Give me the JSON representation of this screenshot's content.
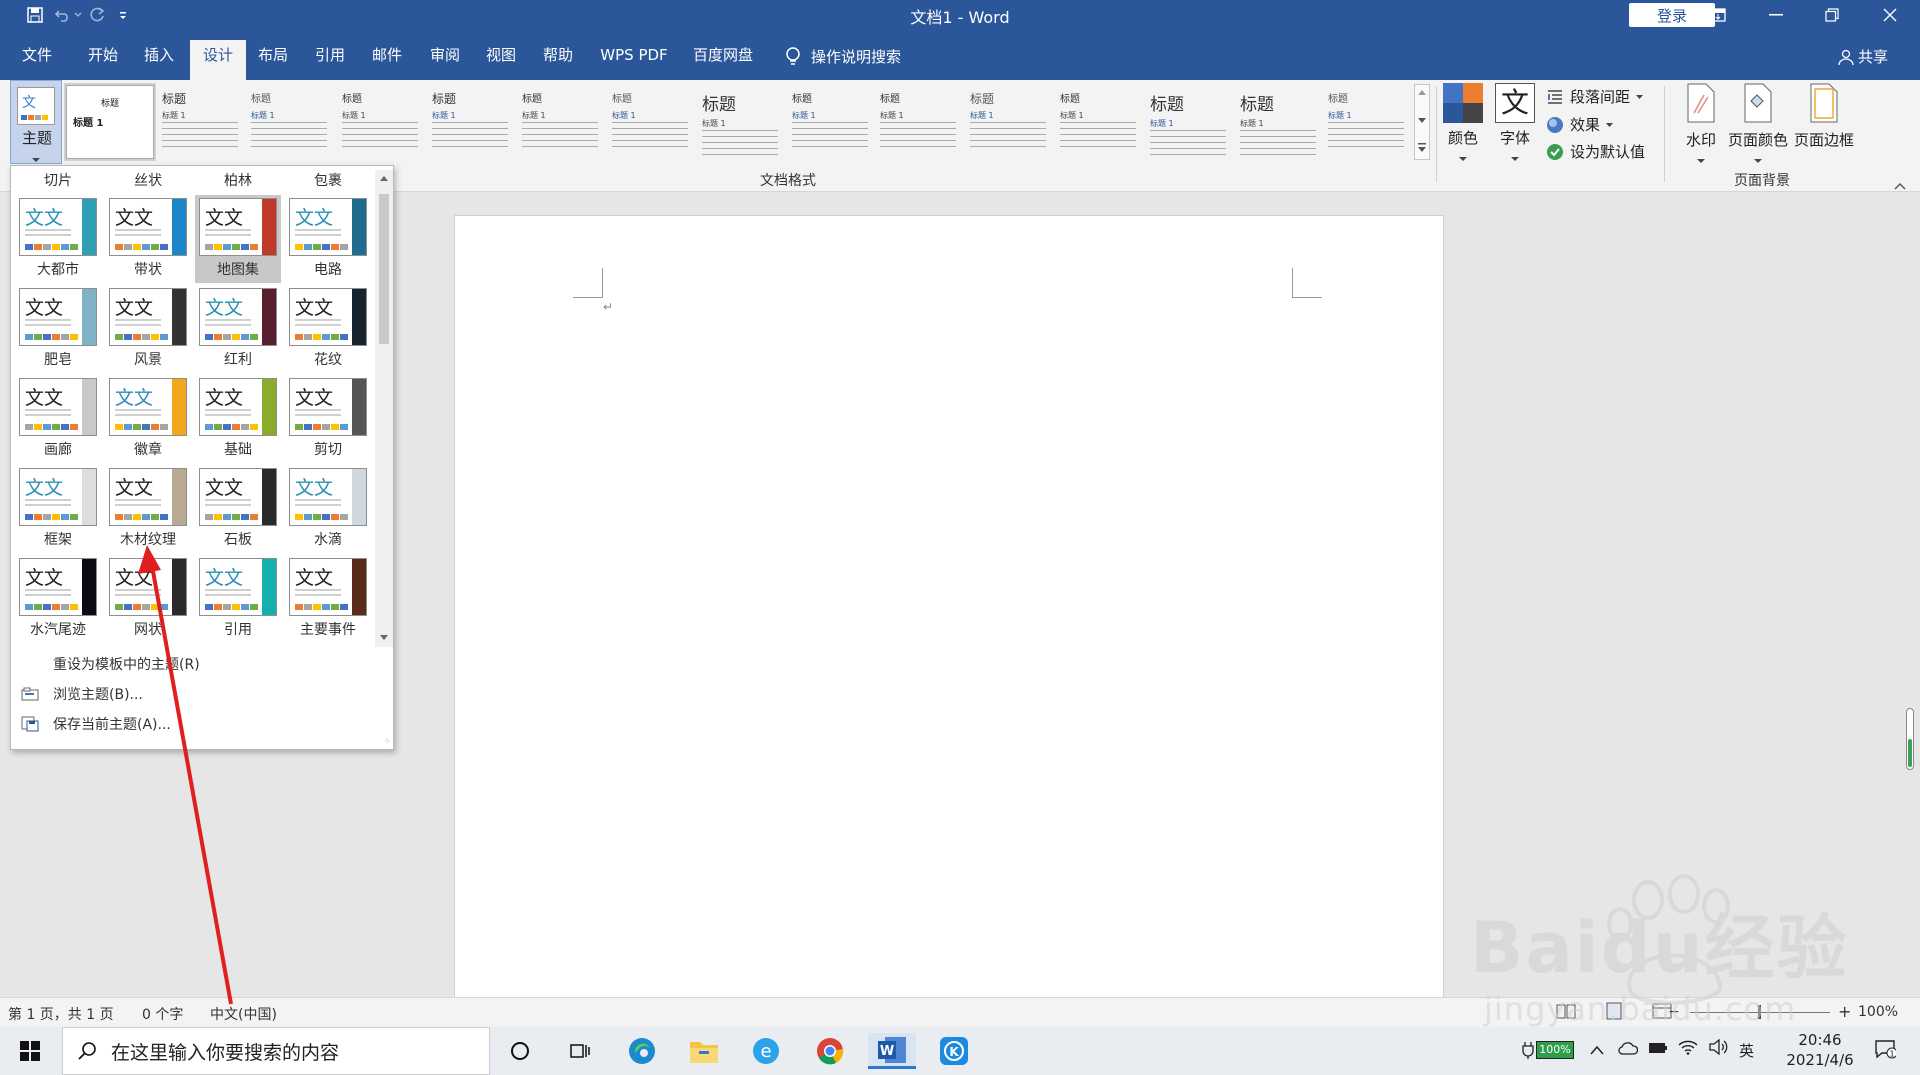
{
  "window": {
    "title": "文档1 - Word",
    "login_label": "登录"
  },
  "tabs": [
    "文件",
    "开始",
    "插入",
    "设计",
    "布局",
    "引用",
    "邮件",
    "审阅",
    "视图",
    "帮助",
    "WPS PDF",
    "百度网盘"
  ],
  "active_tab": "设计",
  "tell_me": "操作说明搜索",
  "share": "共享",
  "ribbon": {
    "theme_button_label": "主题",
    "style_heading": "标题",
    "style_heading1": "标题 1",
    "doc_format_group": "文档格式",
    "colors_label": "颜色",
    "fonts_label": "字体",
    "fonts_glyph": "文",
    "paragraph_spacing": "段落间距",
    "effects": "效果",
    "set_default": "设为默认值",
    "watermark": "水印",
    "page_color": "页面颜色",
    "page_border": "页面边框",
    "page_bg_group": "页面背景"
  },
  "theme_panel": {
    "thumb_glyph": "文文",
    "top_row": [
      "切片",
      "丝状",
      "柏林",
      "包裹"
    ],
    "themes": [
      {
        "name": "大都市",
        "accent": "#2f9fb3"
      },
      {
        "name": "带状",
        "accent": "#1b87c9"
      },
      {
        "name": "地图集",
        "accent": "#c0392b"
      },
      {
        "name": "电路",
        "accent": "#1e6c8e"
      },
      {
        "name": "肥皂",
        "accent": "#7fb2c6"
      },
      {
        "name": "风景",
        "accent": "#333333"
      },
      {
        "name": "红利",
        "accent": "#5a1f2e"
      },
      {
        "name": "花纹",
        "accent": "#15242f"
      },
      {
        "name": "画廊",
        "accent": "#c9c9c9"
      },
      {
        "name": "徽章",
        "accent": "#f2a81d"
      },
      {
        "name": "基础",
        "accent": "#8bab2a"
      },
      {
        "name": "剪切",
        "accent": "#555555"
      },
      {
        "name": "框架",
        "accent": "#dddddd"
      },
      {
        "name": "木材纹理",
        "accent": "#b9a892"
      },
      {
        "name": "石板",
        "accent": "#2a2a2a"
      },
      {
        "name": "水滴",
        "accent": "#cfd7df"
      },
      {
        "name": "水汽尾迹",
        "accent": "#0b0b14"
      },
      {
        "name": "网状",
        "accent": "#2a2a2a"
      },
      {
        "name": "引用",
        "accent": "#13b0ad"
      },
      {
        "name": "主要事件",
        "accent": "#5a2a1a"
      }
    ],
    "selected": "地图集",
    "commands": [
      "重设为模板中的主题(R)",
      "浏览主题(B)...",
      "保存当前主题(A)..."
    ]
  },
  "status": {
    "page": "第 1 页，共 1 页",
    "words": "0 个字",
    "language": "中文(中国)",
    "zoom": "100%"
  },
  "taskbar": {
    "search_placeholder": "在这里输入你要搜索的内容",
    "battery": "100%",
    "ime": "英",
    "time": "20:46",
    "date": "2021/4/6"
  },
  "watermark": {
    "brand": "Baidu经验",
    "url": "jingyan.baidu.com"
  },
  "colors": {
    "word_blue": "#2b579a",
    "annotation_red": "#e02020"
  }
}
